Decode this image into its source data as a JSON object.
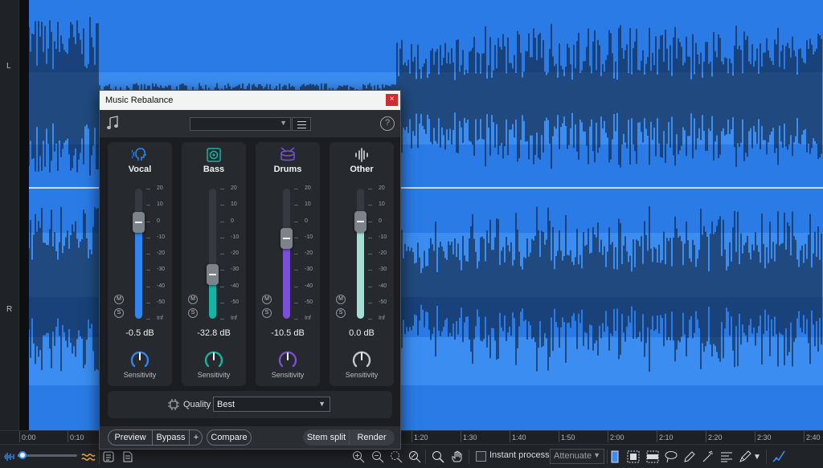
{
  "channels": {
    "left": "L",
    "right": "R"
  },
  "timeline": [
    "0:00",
    "0:10",
    "1:20",
    "1:30",
    "1:40",
    "1:50",
    "2:00",
    "2:10",
    "2:20",
    "2:30",
    "2:40"
  ],
  "colors": {
    "waveform_bg": "#2a7be6",
    "vocal": "#2f86ee",
    "bass": "#17b3a3",
    "drums": "#7b4fd6",
    "other": "#a8ddd6"
  },
  "dialog": {
    "title": "Music Rebalance",
    "close": "×",
    "help": "?",
    "preset_value": "",
    "stems": [
      {
        "name": "Vocal",
        "icon": "vocal-head-icon",
        "value_db": -0.5,
        "value_label": "-0.5 dB",
        "sensitivity": "Sensitivity",
        "has_ms": true
      },
      {
        "name": "Bass",
        "icon": "bass-speaker-icon",
        "value_db": -32.8,
        "value_label": "-32.8 dB",
        "sensitivity": "Sensitivity",
        "has_ms": true
      },
      {
        "name": "Drums",
        "icon": "drum-icon",
        "value_db": -10.5,
        "value_label": "-10.5 dB",
        "sensitivity": "Sensitivity",
        "has_ms": true
      },
      {
        "name": "Other",
        "icon": "other-waveform-icon",
        "value_db": 0.0,
        "value_label": "0.0 dB",
        "sensitivity": "Sensitivity",
        "has_ms": true
      }
    ],
    "fader_scale": [
      "20",
      "10",
      "0",
      "-10",
      "-20",
      "-30",
      "-40",
      "-50",
      "Inf"
    ],
    "mute_label": "M",
    "solo_label": "S",
    "quality": {
      "label": "Quality",
      "value": "Best"
    },
    "footer": {
      "preview": "Preview",
      "bypass": "Bypass",
      "plus": "+",
      "compare": "Compare",
      "stem_split": "Stem split",
      "render": "Render"
    }
  },
  "toolbar": {
    "instant_process": "Instant process",
    "mode": "Attenuate"
  }
}
